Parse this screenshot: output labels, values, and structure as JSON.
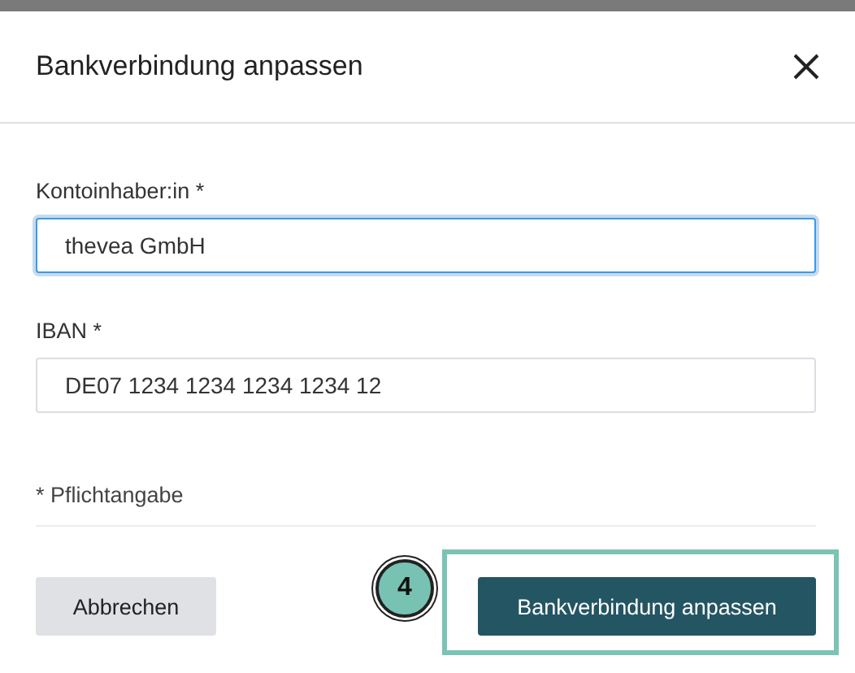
{
  "dialog": {
    "title": "Bankverbindung anpassen"
  },
  "fields": [
    {
      "label": "Kontoinhaber:in *",
      "value": "thevea GmbH",
      "focused": true
    },
    {
      "label": "IBAN *",
      "value": "DE07 1234 1234 1234 1234 12",
      "focused": false
    }
  ],
  "required_note": "* Pflichtangabe",
  "buttons": [
    {
      "label": "Abbrechen",
      "kind": "secondary"
    },
    {
      "label": "Bankverbindung anpassen",
      "kind": "primary",
      "highlighted": true
    }
  ],
  "step_marker": "4"
}
